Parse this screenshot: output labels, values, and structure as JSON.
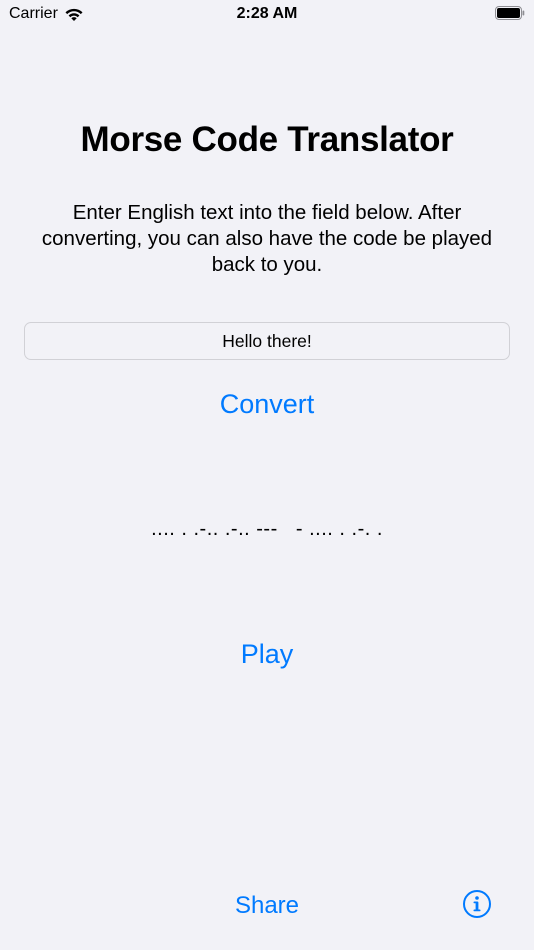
{
  "status_bar": {
    "carrier": "Carrier",
    "time": "2:28 AM"
  },
  "title": "Morse Code Translator",
  "description": "Enter English text into the field below. After converting, you can also have the code be played back to you.",
  "input": {
    "value": "Hello there!"
  },
  "buttons": {
    "convert": "Convert",
    "play": "Play",
    "share": "Share"
  },
  "output": {
    "morse": ".... . .-.. .-.. ---   - .... . .-. ."
  },
  "icons": {
    "info": "info-icon",
    "wifi": "wifi-icon",
    "battery": "battery-icon"
  },
  "colors": {
    "accent": "#007aff",
    "background": "#f2f2f7"
  }
}
